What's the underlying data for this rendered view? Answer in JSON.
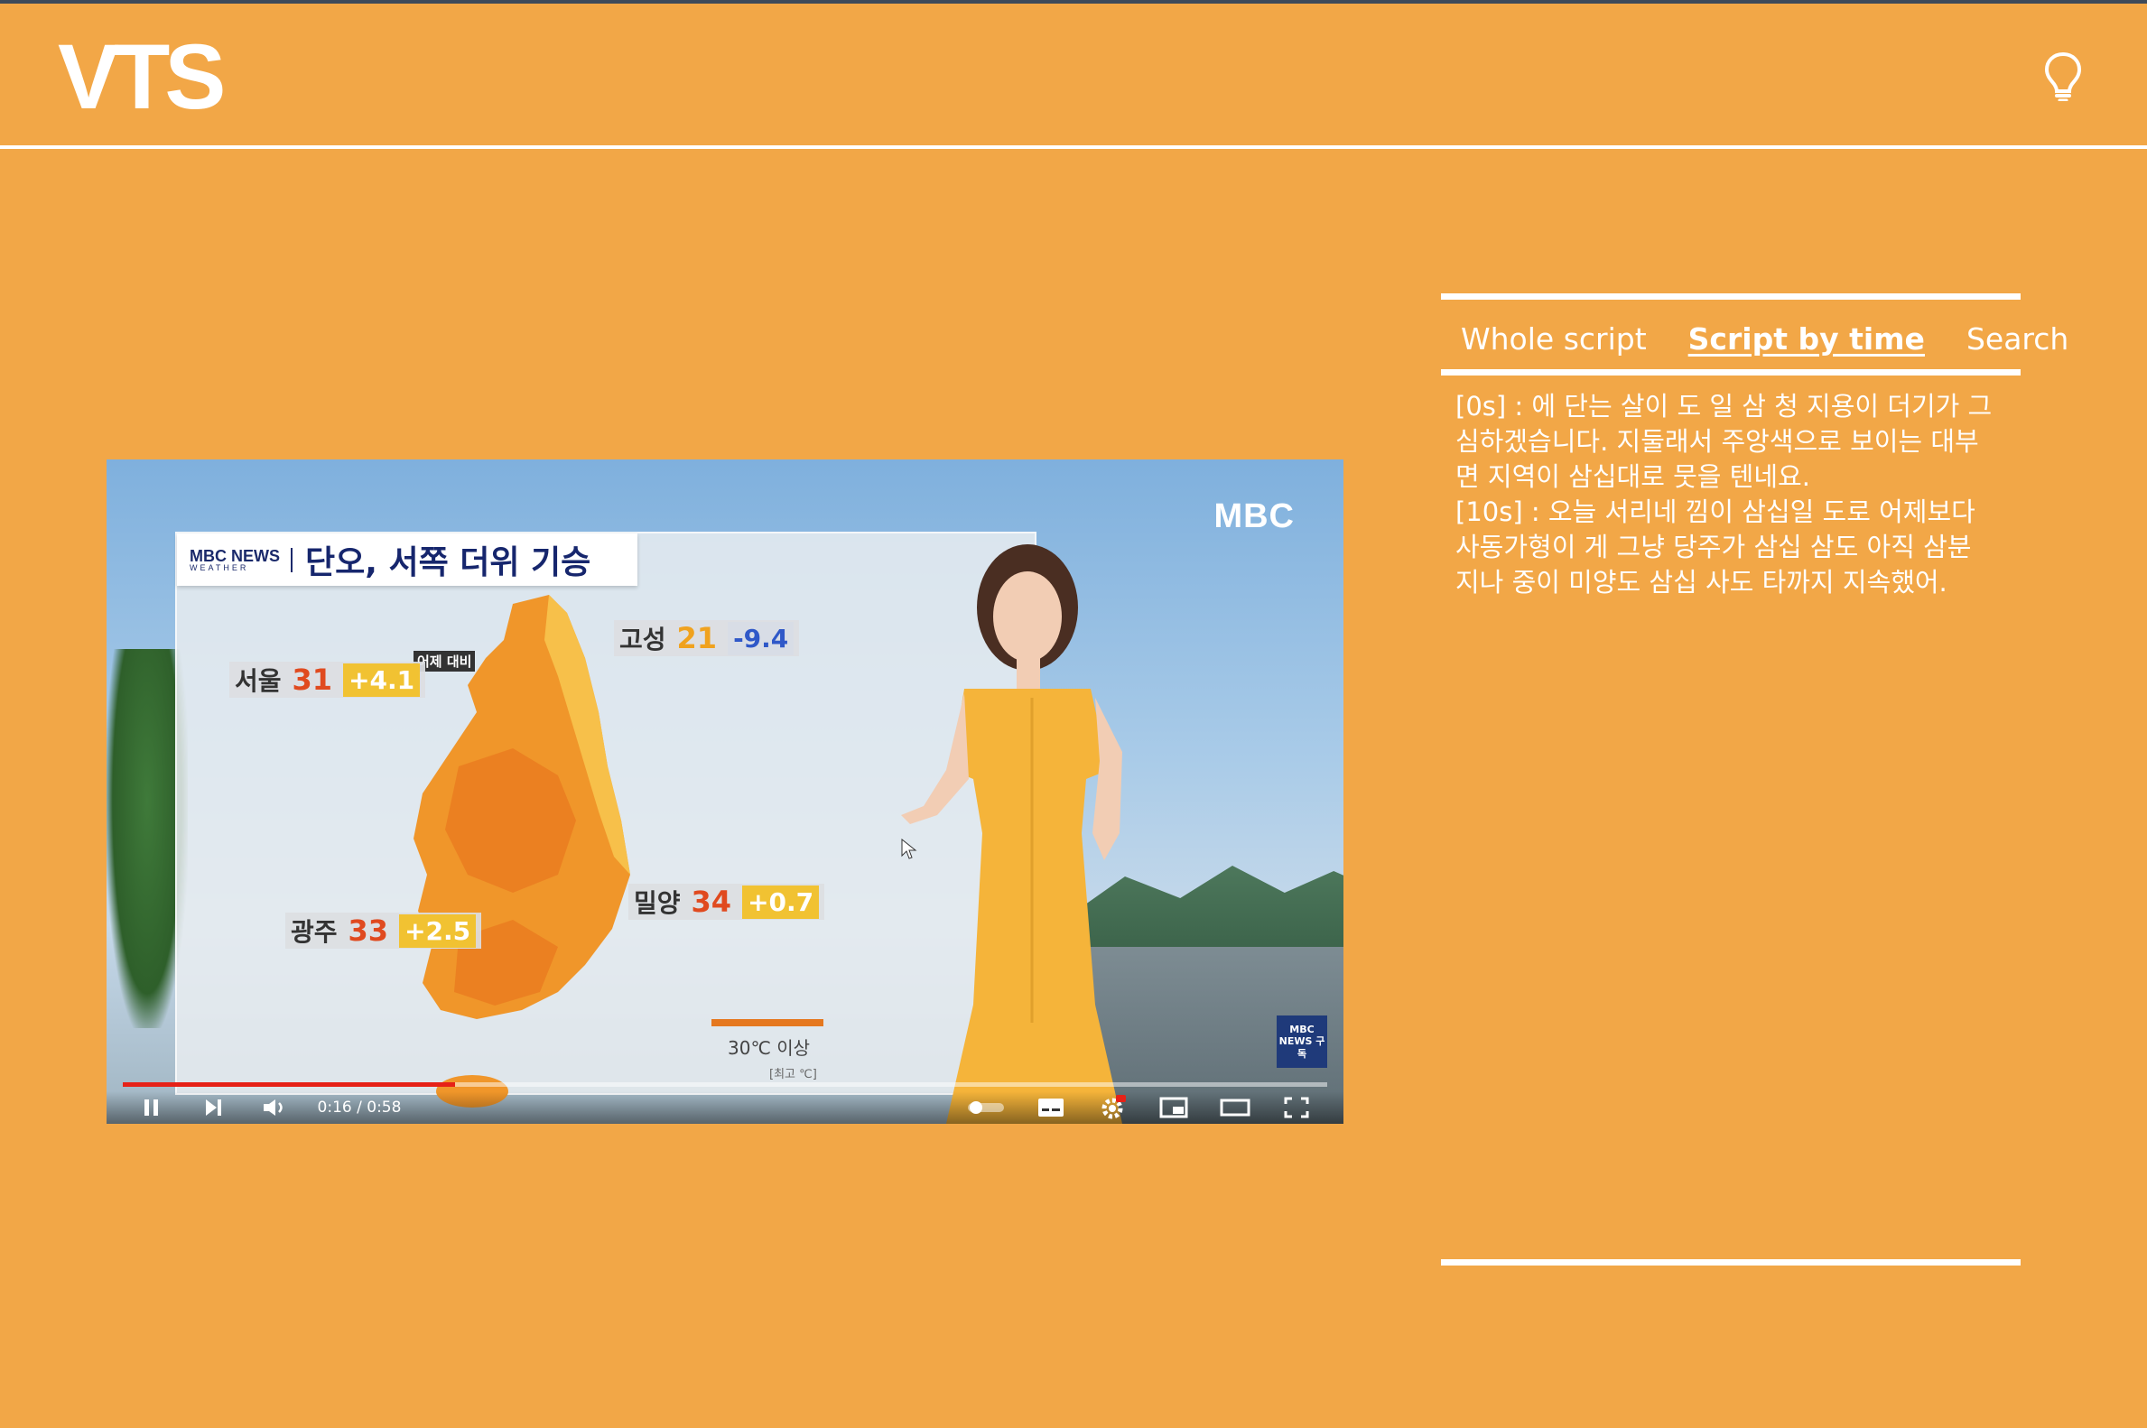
{
  "app": {
    "logo_text": "VTS",
    "hint_icon": "lightbulb-icon"
  },
  "video": {
    "channel_logo": "MBC",
    "news_brand": "MBC NEWS",
    "news_brand_sub": "WEATHER",
    "headline": "단오, 서쪽 더위 기승",
    "diff_caption": "어제 대비",
    "cities": [
      {
        "name": "서울",
        "temp": "31",
        "diff": "+4.1"
      },
      {
        "name": "고성",
        "temp": "21",
        "diff": "-9.4"
      },
      {
        "name": "밀양",
        "temp": "34",
        "diff": "+0.7"
      },
      {
        "name": "광주",
        "temp": "33",
        "diff": "+2.5"
      }
    ],
    "legend_text": "30℃ 이상",
    "legend_sub": "[최고 ℃]",
    "subscribe_badge": "MBC NEWS 구독",
    "time_display": "0:16 / 0:58",
    "progress": 0.276
  },
  "script_panel": {
    "tabs": [
      {
        "label": "Whole script",
        "active": false
      },
      {
        "label": "Script by time",
        "active": true
      },
      {
        "label": "Search",
        "active": false
      }
    ],
    "lines": [
      "[0s] : 에 단는 살이 도 일 삼 청 지용이 더기가 그 심하겠습니다. 지둘래서 주앙색으로 보이는 대부면 지역이 삼십대로 뭇을 텐네요.",
      "[10s] : 오늘 서리네 낌이 삼십일 도로 어제보다 사동가형이 게 그냥 당주가 삼십 삼도 아직 삼분 지나 중이 미양도 삼십 사도 타까지 지속했어."
    ]
  },
  "colors": {
    "background": "#f2a747",
    "foreground": "#ffffff",
    "progress": "#e62117"
  }
}
